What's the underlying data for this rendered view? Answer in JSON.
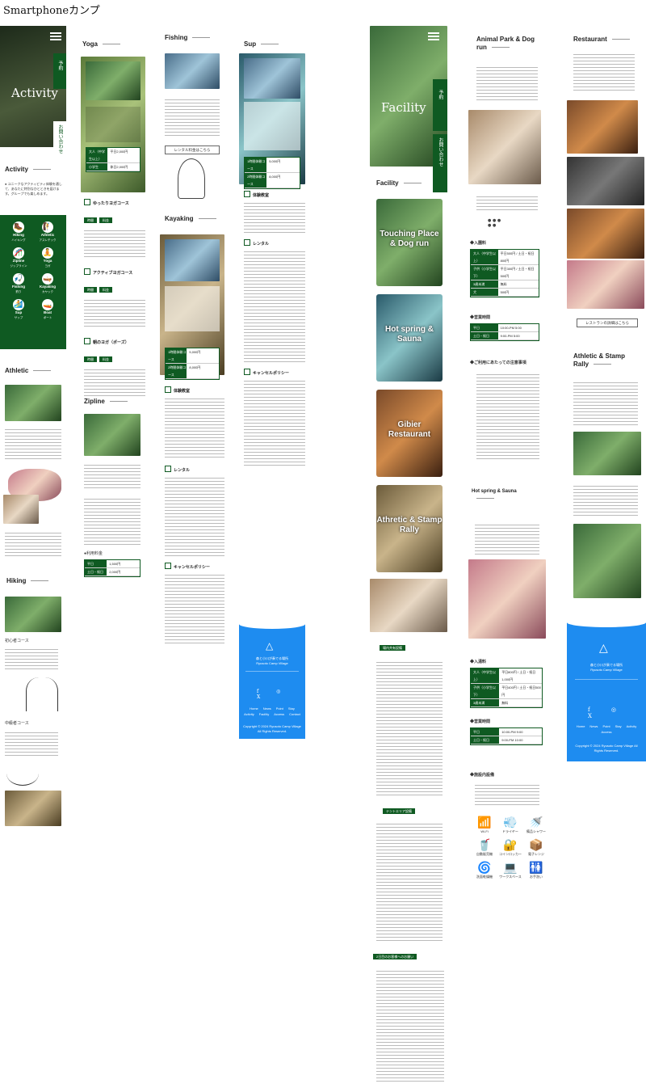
{
  "page": {
    "title": "Smartphoneカンプ"
  },
  "hero_activity": {
    "title": "Activity",
    "reserve": "予約",
    "contact": "お問い合わせ"
  },
  "hero_facility": {
    "title": "Facility",
    "reserve": "予約",
    "contact": "お問い合わせ"
  },
  "activity": {
    "heading": "Activity",
    "intro": "● ユニークなアクティビティ体験を通して、あなたに特別なひとときを届けます。グループでも楽しめます。",
    "items": [
      {
        "label": "Hiking",
        "sub": "ハイキング",
        "icon": "🥾"
      },
      {
        "label": "Athletic",
        "sub": "アスレチック",
        "icon": "🧗"
      },
      {
        "label": "Zipline",
        "sub": "ジップライン",
        "icon": "🎢"
      },
      {
        "label": "Yoga",
        "sub": "ヨガ",
        "icon": "🧘"
      },
      {
        "label": "Fishing",
        "sub": "釣り",
        "icon": "🎣"
      },
      {
        "label": "Kayaking",
        "sub": "カヤック",
        "icon": "🛶"
      },
      {
        "label": "Sup",
        "sub": "サップ",
        "icon": "🏄"
      },
      {
        "label": "Boat",
        "sub": "ボート",
        "icon": "🚤"
      }
    ]
  },
  "athletic_section": {
    "heading": "Athletic"
  },
  "hiking_section": {
    "heading": "Hiking",
    "course1": "初心者コース",
    "course2": "中級者コース"
  },
  "yoga": {
    "heading": "Yoga",
    "table": [
      [
        "大人（中学生以上）",
        "平日2,000円"
      ],
      [
        "小学生",
        "休日2,000円"
      ]
    ],
    "plans": [
      "ゆったりヨガコース",
      "アクティブヨガコース",
      "朝のヨガ（ポーズ）"
    ],
    "badge_time": "時間",
    "badge_price": "料金"
  },
  "fishing": {
    "heading": "Fishing",
    "button": "レンタル料金はこちら"
  },
  "sup": {
    "heading": "Sup",
    "table": [
      [
        "1時間体験コース",
        "5,000円"
      ],
      [
        "2時間体験コース",
        "8,000円"
      ]
    ],
    "sections": [
      "体験教室",
      "レンタル",
      "キャンセルポリシー"
    ],
    "badge1": "1時間体験コース",
    "badge2": "2時間体験コース"
  },
  "kayaking": {
    "heading": "Kayaking",
    "table": [
      [
        "1時間体験コース",
        "5,000円"
      ],
      [
        "2時間体験コース",
        "8,000円"
      ]
    ],
    "sections": [
      "体験教室",
      "レンタル",
      "キャンセルポリシー"
    ]
  },
  "zipline": {
    "heading": "Zipline",
    "price_title": "●利用料金",
    "table": [
      [
        "平日",
        "1,500円"
      ],
      [
        "土日・祝日",
        "2,000円"
      ]
    ]
  },
  "blue_footer": {
    "name": "森と小川が奏でる場所",
    "sub": "Ryusoto Camp Village",
    "nav": [
      "Home",
      "News",
      "Point",
      "Stay",
      "Activity",
      "Facility",
      "Access",
      "Contact"
    ],
    "copyright": "Copyright © 2024 Ryusoto Camp Village All Rights Reserved."
  },
  "facility": {
    "heading": "Facility",
    "cards": [
      "Touching Place & Dog run",
      "Hot spring & Sauna",
      "Gibier Restaurant",
      "Athretic & Stamp Rally"
    ],
    "map_badge": "場内共有設備",
    "tent_badge": "テントエリア設備",
    "notice_badge": "2日目のお客様へのお願い"
  },
  "animal_park": {
    "heading": "Animal Park & Dog run",
    "price_title": "◆入園料",
    "price_table": [
      [
        "大人（中学生以上）",
        "平日500円 / 土日・祝日800円"
      ],
      [
        "子供（小学生以下）",
        "平日300円 / 土日・祝日500円"
      ],
      [
        "3歳未満",
        "無料"
      ],
      [
        "犬",
        "500円"
      ]
    ],
    "hours_title": "◆営業時間",
    "hours_table": [
      [
        "平日",
        "10:00-PM 5:00"
      ],
      [
        "土日・祝日",
        "9:00-PM 5:00"
      ]
    ],
    "notes_title": "◆ご利用にあたっての注意事項"
  },
  "hot_spring": {
    "heading": "Hot spring & Sauna",
    "price_title": "◆入湯料",
    "price_table": [
      [
        "大人（中学生以上）",
        "平日800円 / 土日・祝日1,000円"
      ],
      [
        "子供（小学生以下）",
        "平日400円 / 土日・祝日500円"
      ],
      [
        "3歳未満",
        "無料"
      ]
    ],
    "hours_title": "◆営業時間",
    "hours_table": [
      [
        "平日",
        "10:00-PM 9:00"
      ],
      [
        "土日・祝日",
        "9:00-PM 10:00"
      ]
    ],
    "amenities_title": "◆施設内設備",
    "amenities": [
      {
        "label": "Wi-Fi",
        "icon": "📶"
      },
      {
        "label": "ドライヤー",
        "icon": "💨"
      },
      {
        "label": "備品シャワー",
        "icon": "🚿"
      },
      {
        "label": "自動販売機",
        "icon": "🥤"
      },
      {
        "label": "コインロッカー",
        "icon": "🔐"
      },
      {
        "label": "電子レンジ",
        "icon": "📦"
      },
      {
        "label": "洗面乾燥機",
        "icon": "🌀"
      },
      {
        "label": "ワークスペース",
        "icon": "💻"
      },
      {
        "label": "お手洗い",
        "icon": "🚻"
      }
    ]
  },
  "restaurant": {
    "heading": "Restaurant",
    "button": "レストランの詳細はこちら"
  },
  "athletic_stamp": {
    "heading": "Athletic & Stamp Rally"
  },
  "right_footer": {
    "name": "森と小川が奏でる場所",
    "sub": "Ryusoto Camp Village",
    "nav": [
      "Home",
      "News",
      "Point",
      "Stay",
      "Activity",
      "Access"
    ],
    "copyright": "Copyright © 2024 Ryusoto Camp Village All Rights Reserved."
  }
}
